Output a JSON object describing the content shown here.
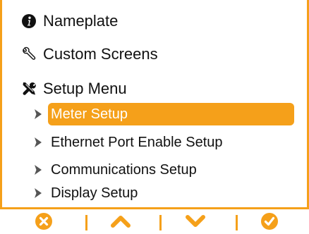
{
  "theme": {
    "accent": "#f5a01a",
    "text": "#111111",
    "selected_text": "#ffffff",
    "background": "#ffffff"
  },
  "menu": {
    "items": [
      {
        "label": "Nameplate",
        "icon": "info-icon"
      },
      {
        "label": "Custom Screens",
        "icon": "wrench-icon"
      },
      {
        "label": "Setup Menu",
        "icon": "tools-icon"
      }
    ],
    "submenu": [
      {
        "label": "Meter Setup",
        "icon": "chevron-right-icon",
        "selected": true
      },
      {
        "label": "Ethernet Port Enable Setup",
        "icon": "chevron-right-icon",
        "selected": false
      },
      {
        "label": "Communications Setup",
        "icon": "chevron-right-icon",
        "selected": false
      },
      {
        "label": "Display Setup",
        "icon": "chevron-right-icon",
        "selected": false
      }
    ]
  },
  "buttons": [
    {
      "icon": "cancel-icon"
    },
    {
      "icon": "chevron-up-icon"
    },
    {
      "icon": "chevron-down-icon"
    },
    {
      "icon": "check-icon"
    }
  ]
}
